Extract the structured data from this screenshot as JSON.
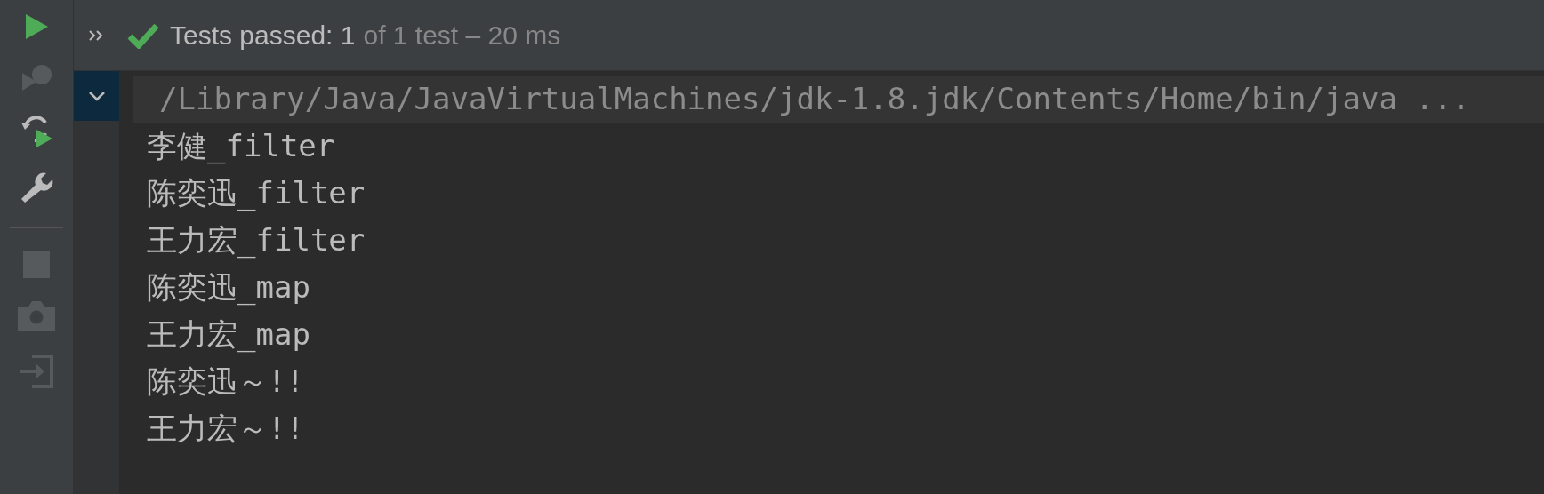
{
  "toolbar": [
    {
      "kind": "run",
      "disabled": false
    },
    {
      "kind": "rerun-failed",
      "disabled": true
    },
    {
      "kind": "toggle-auto-test",
      "disabled": false
    },
    {
      "kind": "settings",
      "disabled": false
    },
    {
      "kind": "divider"
    },
    {
      "kind": "stop",
      "disabled": true
    },
    {
      "kind": "screenshot",
      "disabled": true
    },
    {
      "kind": "import",
      "disabled": true
    }
  ],
  "status": {
    "label": "Tests passed: 1",
    "detail": "of 1 test – 20 ms"
  },
  "test_tree": [
    {
      "expanded": true,
      "selected": true
    }
  ],
  "console": [
    {
      "kind": "command",
      "text": "/Library/Java/JavaVirtualMachines/jdk-1.8.jdk/Contents/Home/bin/java ..."
    },
    {
      "kind": "output",
      "text": "李健_filter"
    },
    {
      "kind": "output",
      "text": "陈奕迅_filter"
    },
    {
      "kind": "output",
      "text": "王力宏_filter"
    },
    {
      "kind": "output",
      "text": "陈奕迅_map"
    },
    {
      "kind": "output",
      "text": "王力宏_map"
    },
    {
      "kind": "output",
      "text": "陈奕迅～!!"
    },
    {
      "kind": "output",
      "text": "王力宏～!!"
    }
  ]
}
